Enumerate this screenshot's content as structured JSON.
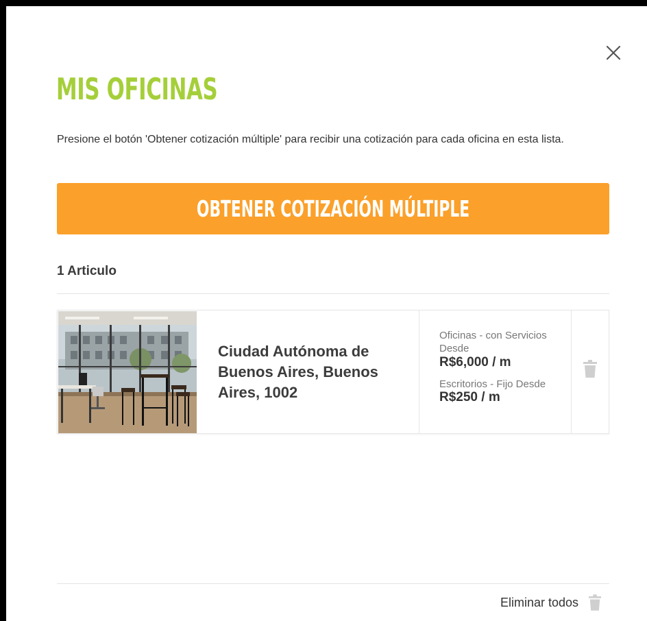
{
  "modal": {
    "title": "MIS OFICINAS",
    "description": "Presione el botón 'Obtener cotización múltiple' para recibir una cotización para cada oficina en esta lista.",
    "cta_label": "OBTENER COTIZACIÓN MÚLTIPLE",
    "item_count": "1 Articulo",
    "close_icon": "close-icon",
    "remove_all_label": "Eliminar todos",
    "remove_all_icon": "trash-icon"
  },
  "items": [
    {
      "address": "Ciudad Autónoma de Buenos Aires, Buenos Aires, 1002",
      "price_1_label": "Oficinas - con Servicios Desde",
      "price_1_value": "R$6,000 / m",
      "price_2_label": "Escritorios - Fijo Desde",
      "price_2_value": "R$250 / m",
      "delete_icon": "trash-icon"
    }
  ],
  "colors": {
    "title": "#a5cf3a",
    "cta": "#fba02a",
    "text": "#333333",
    "muted": "#777777",
    "icon": "#cfcfcf"
  }
}
